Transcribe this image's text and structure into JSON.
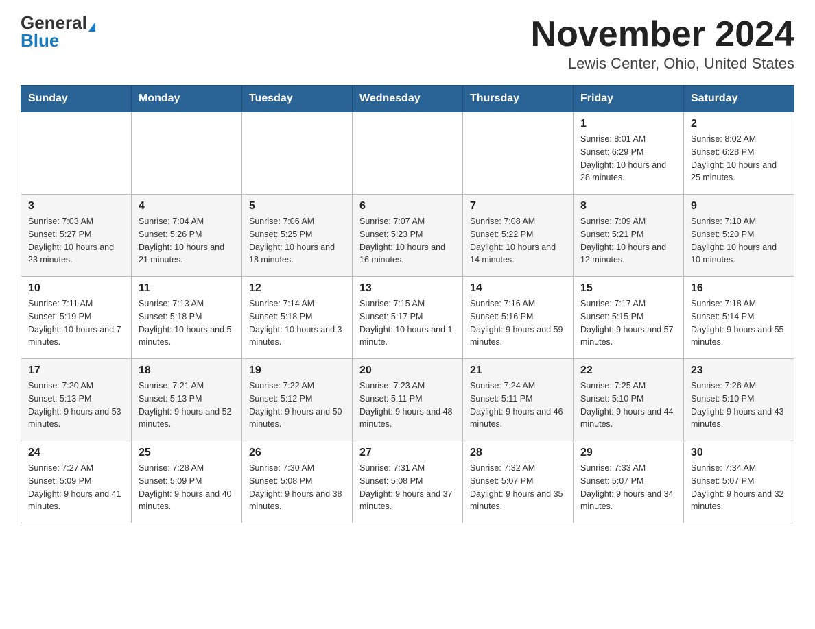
{
  "header": {
    "logo_general": "General",
    "logo_blue": "Blue",
    "title": "November 2024",
    "subtitle": "Lewis Center, Ohio, United States"
  },
  "days_of_week": [
    "Sunday",
    "Monday",
    "Tuesday",
    "Wednesday",
    "Thursday",
    "Friday",
    "Saturday"
  ],
  "weeks": [
    {
      "days": [
        {
          "num": "",
          "info": ""
        },
        {
          "num": "",
          "info": ""
        },
        {
          "num": "",
          "info": ""
        },
        {
          "num": "",
          "info": ""
        },
        {
          "num": "",
          "info": ""
        },
        {
          "num": "1",
          "info": "Sunrise: 8:01 AM\nSunset: 6:29 PM\nDaylight: 10 hours and 28 minutes."
        },
        {
          "num": "2",
          "info": "Sunrise: 8:02 AM\nSunset: 6:28 PM\nDaylight: 10 hours and 25 minutes."
        }
      ]
    },
    {
      "days": [
        {
          "num": "3",
          "info": "Sunrise: 7:03 AM\nSunset: 5:27 PM\nDaylight: 10 hours and 23 minutes."
        },
        {
          "num": "4",
          "info": "Sunrise: 7:04 AM\nSunset: 5:26 PM\nDaylight: 10 hours and 21 minutes."
        },
        {
          "num": "5",
          "info": "Sunrise: 7:06 AM\nSunset: 5:25 PM\nDaylight: 10 hours and 18 minutes."
        },
        {
          "num": "6",
          "info": "Sunrise: 7:07 AM\nSunset: 5:23 PM\nDaylight: 10 hours and 16 minutes."
        },
        {
          "num": "7",
          "info": "Sunrise: 7:08 AM\nSunset: 5:22 PM\nDaylight: 10 hours and 14 minutes."
        },
        {
          "num": "8",
          "info": "Sunrise: 7:09 AM\nSunset: 5:21 PM\nDaylight: 10 hours and 12 minutes."
        },
        {
          "num": "9",
          "info": "Sunrise: 7:10 AM\nSunset: 5:20 PM\nDaylight: 10 hours and 10 minutes."
        }
      ]
    },
    {
      "days": [
        {
          "num": "10",
          "info": "Sunrise: 7:11 AM\nSunset: 5:19 PM\nDaylight: 10 hours and 7 minutes."
        },
        {
          "num": "11",
          "info": "Sunrise: 7:13 AM\nSunset: 5:18 PM\nDaylight: 10 hours and 5 minutes."
        },
        {
          "num": "12",
          "info": "Sunrise: 7:14 AM\nSunset: 5:18 PM\nDaylight: 10 hours and 3 minutes."
        },
        {
          "num": "13",
          "info": "Sunrise: 7:15 AM\nSunset: 5:17 PM\nDaylight: 10 hours and 1 minute."
        },
        {
          "num": "14",
          "info": "Sunrise: 7:16 AM\nSunset: 5:16 PM\nDaylight: 9 hours and 59 minutes."
        },
        {
          "num": "15",
          "info": "Sunrise: 7:17 AM\nSunset: 5:15 PM\nDaylight: 9 hours and 57 minutes."
        },
        {
          "num": "16",
          "info": "Sunrise: 7:18 AM\nSunset: 5:14 PM\nDaylight: 9 hours and 55 minutes."
        }
      ]
    },
    {
      "days": [
        {
          "num": "17",
          "info": "Sunrise: 7:20 AM\nSunset: 5:13 PM\nDaylight: 9 hours and 53 minutes."
        },
        {
          "num": "18",
          "info": "Sunrise: 7:21 AM\nSunset: 5:13 PM\nDaylight: 9 hours and 52 minutes."
        },
        {
          "num": "19",
          "info": "Sunrise: 7:22 AM\nSunset: 5:12 PM\nDaylight: 9 hours and 50 minutes."
        },
        {
          "num": "20",
          "info": "Sunrise: 7:23 AM\nSunset: 5:11 PM\nDaylight: 9 hours and 48 minutes."
        },
        {
          "num": "21",
          "info": "Sunrise: 7:24 AM\nSunset: 5:11 PM\nDaylight: 9 hours and 46 minutes."
        },
        {
          "num": "22",
          "info": "Sunrise: 7:25 AM\nSunset: 5:10 PM\nDaylight: 9 hours and 44 minutes."
        },
        {
          "num": "23",
          "info": "Sunrise: 7:26 AM\nSunset: 5:10 PM\nDaylight: 9 hours and 43 minutes."
        }
      ]
    },
    {
      "days": [
        {
          "num": "24",
          "info": "Sunrise: 7:27 AM\nSunset: 5:09 PM\nDaylight: 9 hours and 41 minutes."
        },
        {
          "num": "25",
          "info": "Sunrise: 7:28 AM\nSunset: 5:09 PM\nDaylight: 9 hours and 40 minutes."
        },
        {
          "num": "26",
          "info": "Sunrise: 7:30 AM\nSunset: 5:08 PM\nDaylight: 9 hours and 38 minutes."
        },
        {
          "num": "27",
          "info": "Sunrise: 7:31 AM\nSunset: 5:08 PM\nDaylight: 9 hours and 37 minutes."
        },
        {
          "num": "28",
          "info": "Sunrise: 7:32 AM\nSunset: 5:07 PM\nDaylight: 9 hours and 35 minutes."
        },
        {
          "num": "29",
          "info": "Sunrise: 7:33 AM\nSunset: 5:07 PM\nDaylight: 9 hours and 34 minutes."
        },
        {
          "num": "30",
          "info": "Sunrise: 7:34 AM\nSunset: 5:07 PM\nDaylight: 9 hours and 32 minutes."
        }
      ]
    }
  ]
}
